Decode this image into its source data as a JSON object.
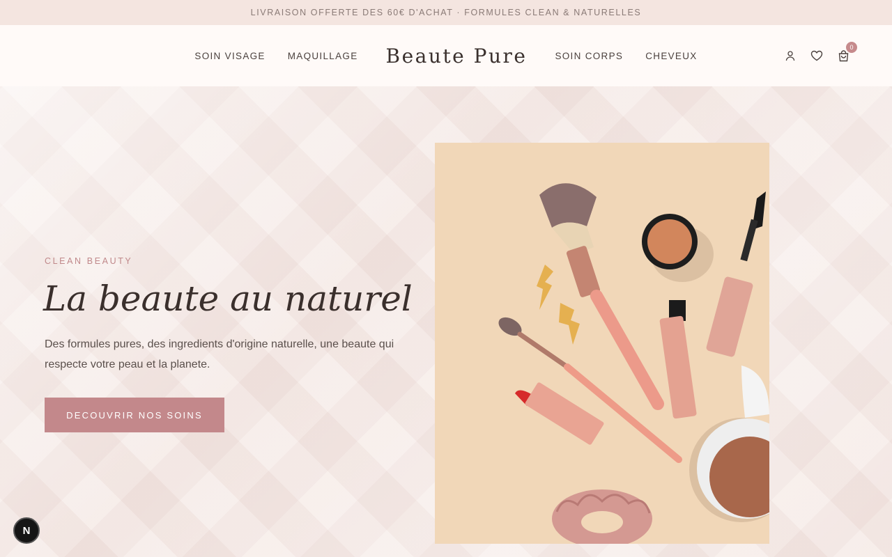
{
  "announcement": "LIVRAISON OFFERTE DES 60€ D'ACHAT · FORMULES CLEAN & NATURELLES",
  "nav": {
    "left": [
      "SOIN VISAGE",
      "MAQUILLAGE"
    ],
    "right": [
      "SOIN CORPS",
      "CHEVEUX"
    ],
    "logo": "Beaute Pure"
  },
  "header_icons": {
    "account": "user-icon",
    "wishlist": "heart-icon",
    "cart": "shopping-bag-icon",
    "cart_count": "0"
  },
  "hero": {
    "eyebrow": "CLEAN BEAUTY",
    "title": "La beaute au naturel",
    "description": "Des formules pures, des ingredients d'origine naturelle, une beaute qui respecte votre peau et la planete.",
    "cta": "DECOUVRIR NOS SOINS",
    "image_subject": "flat lay of makeup brushes, lipstick, mascara, blush compacts, lightning bolt earrings and a pink velvet scrunchie"
  },
  "floating_badge": "N",
  "colors": {
    "accent": "#c3888b",
    "announcement_bg": "#f4e5e0",
    "header_bg": "#fffaf8",
    "hero_image_bg": "#f1d7b8",
    "text_dark": "#3a2f2c"
  }
}
